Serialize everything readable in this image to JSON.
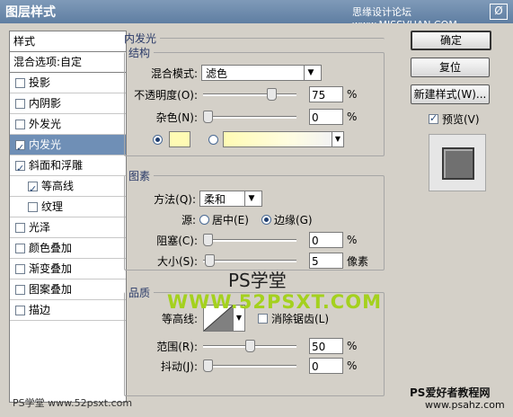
{
  "window": {
    "title": "图层样式",
    "watermark_top": "思缘设计论坛 www.MISSVUAN.COM",
    "close_symbol": "Ø"
  },
  "sidebar": {
    "header": "样式",
    "blend_options": "混合选项:自定",
    "items": [
      {
        "label": "投影",
        "checked": false,
        "sub": false,
        "selected": false
      },
      {
        "label": "内阴影",
        "checked": false,
        "sub": false,
        "selected": false
      },
      {
        "label": "外发光",
        "checked": false,
        "sub": false,
        "selected": false
      },
      {
        "label": "内发光",
        "checked": true,
        "sub": false,
        "selected": true
      },
      {
        "label": "斜面和浮雕",
        "checked": true,
        "sub": false,
        "selected": false
      },
      {
        "label": "等高线",
        "checked": true,
        "sub": true,
        "selected": false
      },
      {
        "label": "纹理",
        "checked": false,
        "sub": true,
        "selected": false
      },
      {
        "label": "光泽",
        "checked": false,
        "sub": false,
        "selected": false
      },
      {
        "label": "颜色叠加",
        "checked": false,
        "sub": false,
        "selected": false
      },
      {
        "label": "渐变叠加",
        "checked": false,
        "sub": false,
        "selected": false
      },
      {
        "label": "图案叠加",
        "checked": false,
        "sub": false,
        "selected": false
      },
      {
        "label": "描边",
        "checked": false,
        "sub": false,
        "selected": false
      }
    ]
  },
  "inner_glow": {
    "title": "内发光",
    "structure": {
      "title": "结构",
      "blend_mode_label": "混合模式:",
      "blend_mode_value": "滤色",
      "opacity_label": "不透明度(O):",
      "opacity_value": "75",
      "opacity_level": 0.75,
      "noise_label": "杂色(N):",
      "noise_value": "0",
      "noise_level": 0,
      "pct": "%",
      "glow_color": "#fffbb4"
    },
    "elements": {
      "title": "图素",
      "method_label": "方法(Q):",
      "method_value": "柔和",
      "source_label": "源:",
      "source_center": "居中(E)",
      "source_edge": "边缘(G)",
      "choke_label": "阻塞(C):",
      "choke_value": "0",
      "choke_level": 0,
      "size_label": "大小(S):",
      "size_value": "5",
      "size_unit": "像素",
      "size_level": 0.02
    },
    "quality": {
      "title": "品质",
      "contour_label": "等高线:",
      "antialias_label": "消除锯齿(L)",
      "range_label": "范围(R):",
      "range_value": "50",
      "range_level": 0.5,
      "jitter_label": "抖动(J):",
      "jitter_value": "0",
      "jitter_level": 0
    }
  },
  "buttons": {
    "ok": "确定",
    "reset": "复位",
    "new_style": "新建样式(W)...",
    "preview_label": "预览(V)"
  },
  "watermarks": {
    "center": "PS学堂",
    "url": "WWW.52PSXT.COM",
    "bottom_left": "PS学堂 www.52psxt.com",
    "bottom_right": "PS爱好者教程网",
    "bottom_right_url": "www.psahz.com"
  }
}
